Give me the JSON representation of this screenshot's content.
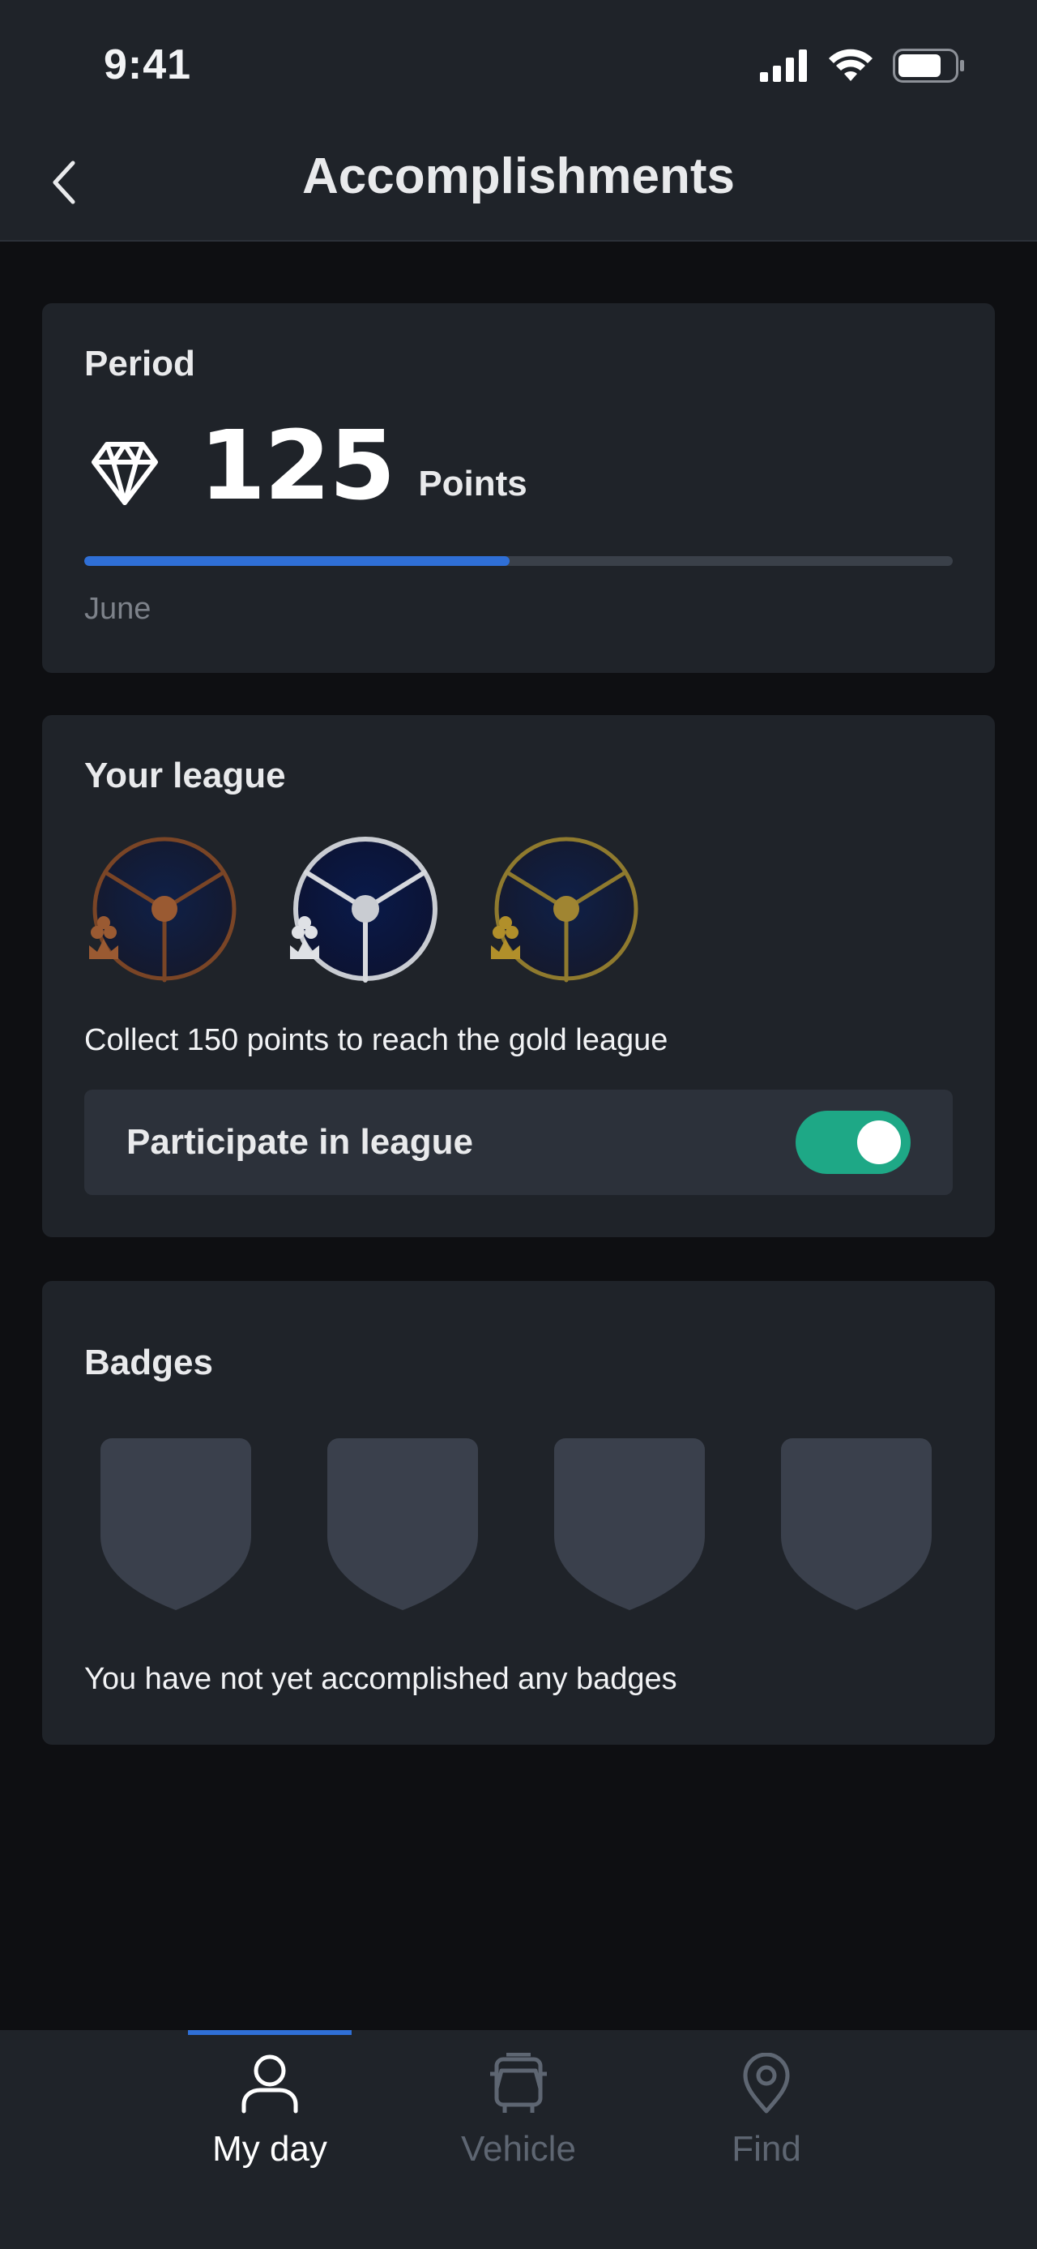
{
  "status_bar": {
    "time": "9:41"
  },
  "header": {
    "title": "Accomplishments"
  },
  "period": {
    "title": "Period",
    "points": "125",
    "points_unit": "Points",
    "progress_fraction": 0.49,
    "label": "June",
    "colors": {
      "progress": "#2f6fd6",
      "track": "#3a4049"
    }
  },
  "league": {
    "title": "Your league",
    "icons": [
      "bronze-league-icon",
      "silver-league-icon",
      "gold-league-icon"
    ],
    "message": "Collect 150 points to reach the gold league",
    "participate_label": "Participate in league",
    "participate_on": true,
    "colors": {
      "bronze": "#8a4f2a",
      "silver": "#c9ccd2",
      "gold": "#a08532",
      "toggle_on": "#1ea886"
    }
  },
  "badges": {
    "title": "Badges",
    "count_placeholders": 4,
    "message": "You have not yet accomplished any badges"
  },
  "tab_bar": {
    "tabs": [
      {
        "label": "My day",
        "icon": "person-icon",
        "active": true
      },
      {
        "label": "Vehicle",
        "icon": "bus-icon",
        "active": false
      },
      {
        "label": "Find",
        "icon": "location-pin-icon",
        "active": false
      }
    ],
    "colors": {
      "active": "#ffffff",
      "inactive": "#5e6672",
      "indicator": "#2f6fd6"
    }
  }
}
